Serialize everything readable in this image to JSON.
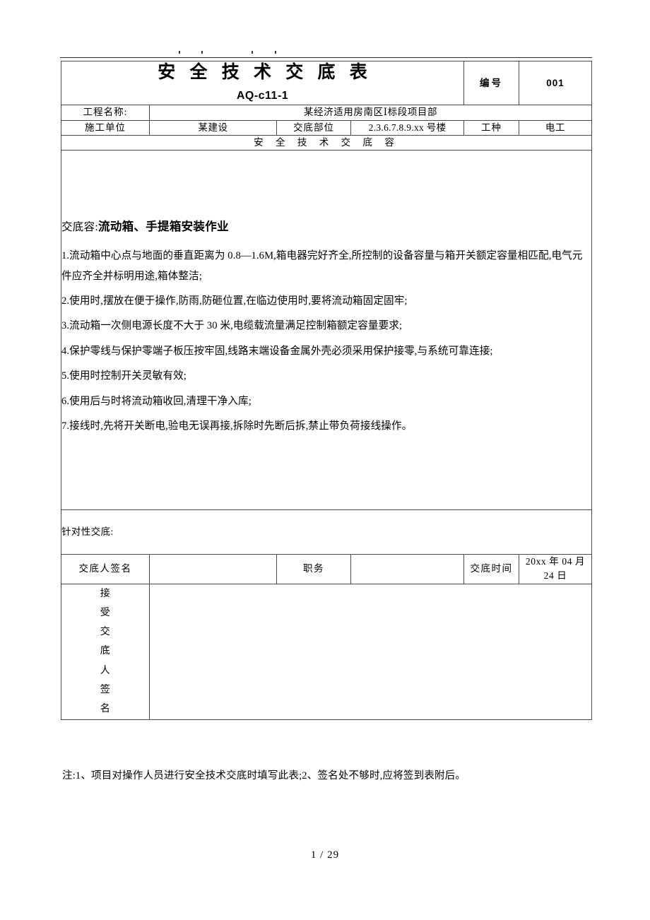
{
  "document": {
    "title_main": "安 全 技 术 交 底 表",
    "title_sub": "AQ-c11-1",
    "number_label": "编号",
    "number_value": "001"
  },
  "header_rule": {
    "ticks": [
      253,
      285,
      356,
      389
    ]
  },
  "info": {
    "project_label": "工程名称:",
    "project_value": "某经济适用房南区Ⅰ标段项目部",
    "unit_label": "施工单位",
    "unit_value": "某建设",
    "part_label": "交底部位",
    "part_value": "2.3.6.7.8.9.xx 号楼",
    "trade_label": "工种",
    "trade_value": "电工"
  },
  "section": {
    "heading": "安 全 技 术 交 底  容"
  },
  "content": {
    "subject_label": "交底容:",
    "subject_value": "流动箱、手提箱安装作业",
    "items": [
      "1.流动箱中心点与地面的垂直距离为 0.8—1.6M,箱电器完好齐全,所控制的设备容量与箱开关额定容量相匹配,电气元件应齐全并标明用途,箱体整洁;",
      "2.使用时,摆放在便于操作,防雨,防砸位置,在临边使用时,要将流动箱固定固牢;",
      "3.流动箱一次侧电源长度不大于 30 米,电缆载流量满足控制箱额定容量要求;",
      "4.保护零线与保护零端子板压按牢固,线路末端设备金属外壳必须采用保护接零,与系统可靠连接;",
      "5.使用时控制开关灵敏有效;",
      "6.使用后与时将流动箱收回,清理干净入库;",
      "7.接线时,先将开关断电,验电无误再接,拆除时先断后拆,禁止带负荷接线操作。"
    ]
  },
  "targeted": {
    "label": "针对性交底:",
    "value": ""
  },
  "signature": {
    "presenter_label": "交底人签名",
    "presenter_value": "",
    "position_label": "职务",
    "position_value": "",
    "time_label": "交底时间",
    "time_value": "20xx 年 04 月 24 日",
    "receiver_label_chars": [
      "接",
      "受",
      "交",
      "底",
      "人",
      "签",
      "名"
    ],
    "receiver_value": ""
  },
  "footer": {
    "note": "注:1、项目对操作人员进行安全技术交底时填写此表;2、签名处不够时,应将签到表附后。",
    "page_number": "1 / 29"
  }
}
